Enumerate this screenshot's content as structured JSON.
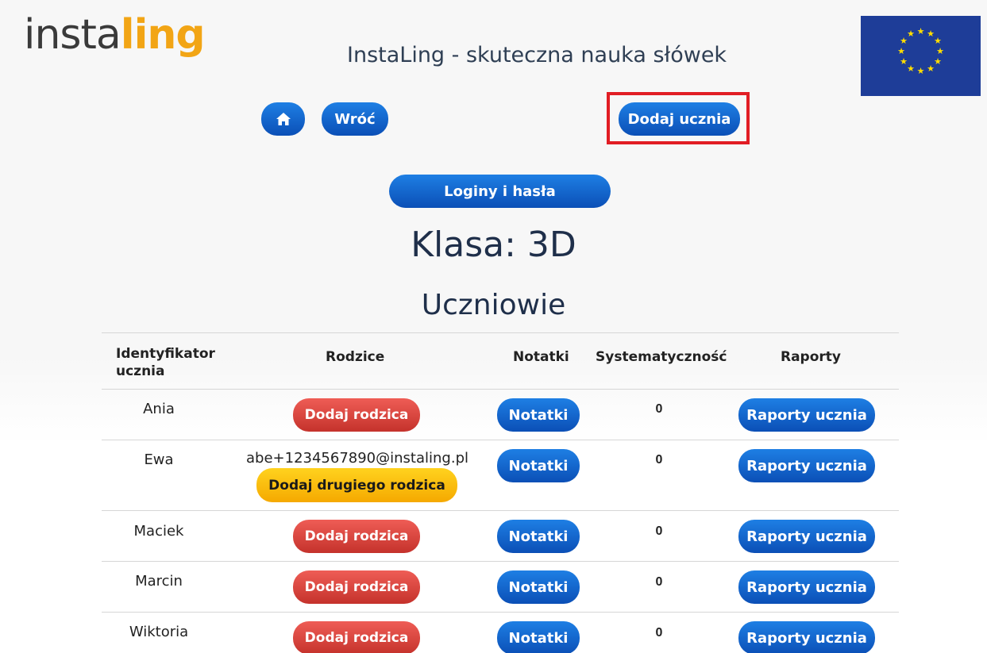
{
  "header": {
    "logo_part1": "insta",
    "logo_part2": "ling",
    "site_title": "InstaLing - skuteczna nauka słówek"
  },
  "nav": {
    "home_icon": "home-icon",
    "back_label": "Wróć",
    "add_student_label": "Dodaj ucznia",
    "logins_label": "Loginy i hasła"
  },
  "class_heading": "Klasa: 3D",
  "section_heading": "Uczniowie",
  "table": {
    "headers": {
      "id_line1": "Identyfikator",
      "id_line2": "ucznia",
      "parents": "Rodzice",
      "notes": "Notatki",
      "regularity": "Systematyczność",
      "reports": "Raporty"
    },
    "rows": [
      {
        "name": "Ania",
        "parent_email": "",
        "parent_button": "Dodaj rodzica",
        "notes_button": "Notatki",
        "regularity": "0",
        "reports_button": "Raporty ucznia"
      },
      {
        "name": "Ewa",
        "parent_email": "abe+1234567890@instaling.pl",
        "parent_button": "Dodaj drugiego rodzica",
        "notes_button": "Notatki",
        "regularity": "0",
        "reports_button": "Raporty ucznia"
      },
      {
        "name": "Maciek",
        "parent_email": "",
        "parent_button": "Dodaj rodzica",
        "notes_button": "Notatki",
        "regularity": "0",
        "reports_button": "Raporty ucznia"
      },
      {
        "name": "Marcin",
        "parent_email": "",
        "parent_button": "Dodaj rodzica",
        "notes_button": "Notatki",
        "regularity": "0",
        "reports_button": "Raporty ucznia"
      },
      {
        "name": "Wiktoria",
        "parent_email": "",
        "parent_button": "Dodaj rodzica",
        "notes_button": "Notatki",
        "regularity": "0",
        "reports_button": "Raporty ucznia"
      }
    ]
  },
  "colors": {
    "accent_blue": "#0b5ed7",
    "button_red": "#d9443e",
    "button_yellow": "#f5b800",
    "logo_orange": "#f2a515",
    "highlight_red": "#e11d24",
    "eu_blue": "#1e3d98",
    "eu_star": "#ffdd00"
  }
}
